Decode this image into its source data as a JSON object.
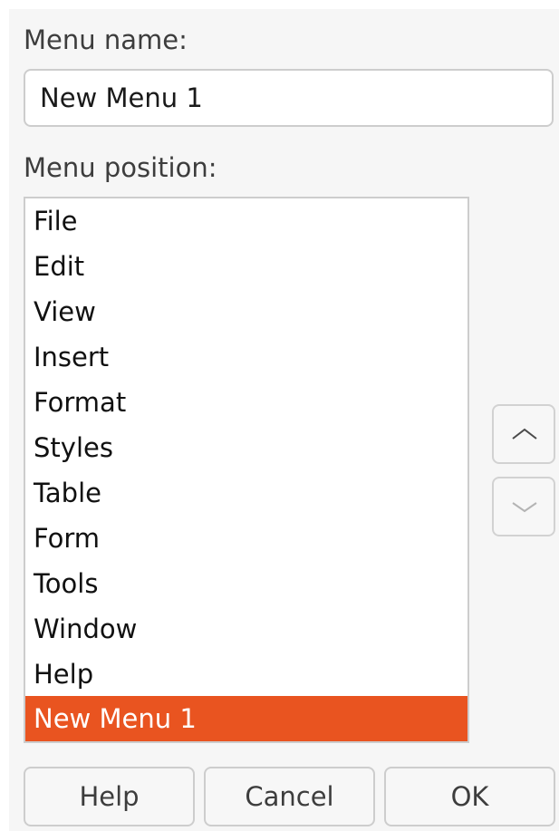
{
  "menu_name": {
    "label": "Menu name:",
    "value": "New Menu 1"
  },
  "menu_position": {
    "label": "Menu position:",
    "items": [
      "File",
      "Edit",
      "View",
      "Insert",
      "Format",
      "Styles",
      "Table",
      "Form",
      "Tools",
      "Window",
      "Help",
      "New Menu 1"
    ],
    "selected_index": 11
  },
  "move_buttons": {
    "up_icon": "chevron-up-icon",
    "down_icon": "chevron-down-icon"
  },
  "buttons": {
    "help": "Help",
    "cancel": "Cancel",
    "ok": "OK"
  },
  "colors": {
    "selection": "#e95420"
  }
}
